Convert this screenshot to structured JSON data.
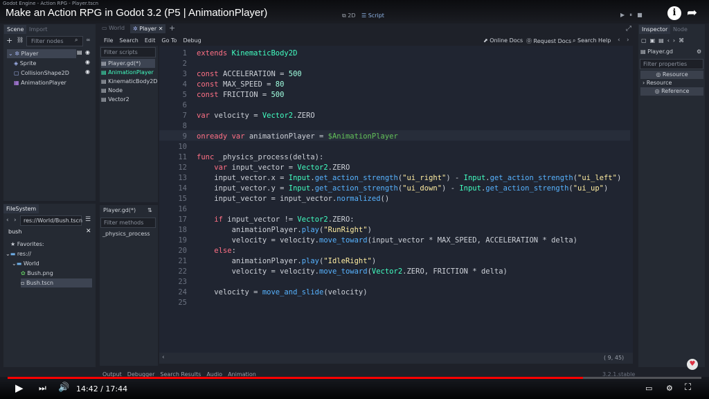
{
  "engine_title": "Godot Engine - Action RPG - Player.tscn",
  "video_title": "Make an Action RPG in Godot 3.2 (P5 | AnimationPlayer)",
  "workspace": {
    "mode_2d": "2D",
    "mode_script": "Script"
  },
  "scene_dock": {
    "tabs": [
      "Scene",
      "Import"
    ],
    "filter_placeholder": "Filter nodes",
    "nodes": [
      {
        "label": "Player",
        "icon": "kinematic-body-icon",
        "depth": 0
      },
      {
        "label": "Sprite",
        "icon": "sprite-icon",
        "depth": 1
      },
      {
        "label": "CollisionShape2D",
        "icon": "collision-shape-icon",
        "depth": 1
      },
      {
        "label": "AnimationPlayer",
        "icon": "animation-player-icon",
        "depth": 1
      }
    ]
  },
  "filesystem_dock": {
    "tab": "FileSystem",
    "path": "res://World/Bush.tscn",
    "search": "bush",
    "items": [
      {
        "label": "Favorites:",
        "icon": "star-icon",
        "depth": 0
      },
      {
        "label": "res://",
        "icon": "folder-icon",
        "depth": 0
      },
      {
        "label": "World",
        "icon": "folder-icon",
        "depth": 1
      },
      {
        "label": "Bush.png",
        "icon": "image-icon",
        "depth": 2
      },
      {
        "label": "Bush.tscn",
        "icon": "scene-icon",
        "depth": 2
      }
    ]
  },
  "editor_tabs": [
    "World",
    "Player"
  ],
  "script_menu": [
    "File",
    "Search",
    "Edit",
    "Go To",
    "Debug"
  ],
  "script_toolbar": [
    "Online Docs",
    "Request Docs",
    "Search Help"
  ],
  "script_list": {
    "filter_placeholder": "Filter scripts",
    "items": [
      "Player.gd(*)",
      "AnimationPlayer",
      "KinematicBody2D",
      "Node",
      "Vector2"
    ]
  },
  "method_panel": {
    "title": "Player.gd(*)",
    "filter_placeholder": "Filter methods",
    "methods": [
      "_physics_process"
    ]
  },
  "code_lines": [
    {
      "n": "1",
      "tokens": [
        {
          "t": "extends ",
          "c": "kw"
        },
        {
          "t": "KinematicBody2D",
          "c": "ty"
        }
      ]
    },
    {
      "n": "2",
      "tokens": []
    },
    {
      "n": "3",
      "tokens": [
        {
          "t": "const ",
          "c": "kw"
        },
        {
          "t": "ACCELERATION = ",
          "c": "tx"
        },
        {
          "t": "500",
          "c": "nu"
        }
      ]
    },
    {
      "n": "4",
      "tokens": [
        {
          "t": "const ",
          "c": "kw"
        },
        {
          "t": "MAX_SPEED = ",
          "c": "tx"
        },
        {
          "t": "80",
          "c": "nu"
        }
      ]
    },
    {
      "n": "5",
      "tokens": [
        {
          "t": "const ",
          "c": "kw"
        },
        {
          "t": "FRICTION = ",
          "c": "tx"
        },
        {
          "t": "500",
          "c": "nu"
        }
      ]
    },
    {
      "n": "6",
      "tokens": []
    },
    {
      "n": "7",
      "tokens": [
        {
          "t": "var ",
          "c": "kw"
        },
        {
          "t": "velocity = ",
          "c": "tx"
        },
        {
          "t": "Vector2",
          "c": "ty"
        },
        {
          "t": ".ZERO",
          "c": "tx"
        }
      ]
    },
    {
      "n": "8",
      "tokens": []
    },
    {
      "n": "9",
      "tokens": [
        {
          "t": "onready var ",
          "c": "kw"
        },
        {
          "t": "animationPlayer = ",
          "c": "tx"
        },
        {
          "t": "$AnimationPlayer",
          "c": "np"
        }
      ]
    },
    {
      "n": "10",
      "tokens": []
    },
    {
      "n": "11",
      "tokens": [
        {
          "t": "func ",
          "c": "kw"
        },
        {
          "t": "_physics_process(delta):",
          "c": "tx"
        }
      ]
    },
    {
      "n": "12",
      "tokens": [
        {
          "t": "    var ",
          "c": "kw"
        },
        {
          "t": "input_vector = ",
          "c": "tx"
        },
        {
          "t": "Vector2",
          "c": "ty"
        },
        {
          "t": ".ZERO",
          "c": "tx"
        }
      ]
    },
    {
      "n": "13",
      "tokens": [
        {
          "t": "    input_vector.x = ",
          "c": "tx"
        },
        {
          "t": "Input",
          "c": "ty"
        },
        {
          "t": ".",
          "c": "tx"
        },
        {
          "t": "get_action_strength",
          "c": "fn"
        },
        {
          "t": "(",
          "c": "tx"
        },
        {
          "t": "\"ui_right\"",
          "c": "st"
        },
        {
          "t": ") - ",
          "c": "tx"
        },
        {
          "t": "Input",
          "c": "ty"
        },
        {
          "t": ".",
          "c": "tx"
        },
        {
          "t": "get_action_strength",
          "c": "fn"
        },
        {
          "t": "(",
          "c": "tx"
        },
        {
          "t": "\"ui_left\"",
          "c": "st"
        },
        {
          "t": ")",
          "c": "tx"
        }
      ]
    },
    {
      "n": "14",
      "tokens": [
        {
          "t": "    input_vector.y = ",
          "c": "tx"
        },
        {
          "t": "Input",
          "c": "ty"
        },
        {
          "t": ".",
          "c": "tx"
        },
        {
          "t": "get_action_strength",
          "c": "fn"
        },
        {
          "t": "(",
          "c": "tx"
        },
        {
          "t": "\"ui_down\"",
          "c": "st"
        },
        {
          "t": ") - ",
          "c": "tx"
        },
        {
          "t": "Input",
          "c": "ty"
        },
        {
          "t": ".",
          "c": "tx"
        },
        {
          "t": "get_action_strength",
          "c": "fn"
        },
        {
          "t": "(",
          "c": "tx"
        },
        {
          "t": "\"ui_up\"",
          "c": "st"
        },
        {
          "t": ")",
          "c": "tx"
        }
      ]
    },
    {
      "n": "15",
      "tokens": [
        {
          "t": "    input_vector = input_vector.",
          "c": "tx"
        },
        {
          "t": "normalized",
          "c": "fn"
        },
        {
          "t": "()",
          "c": "tx"
        }
      ]
    },
    {
      "n": "16",
      "tokens": []
    },
    {
      "n": "17",
      "tokens": [
        {
          "t": "    if ",
          "c": "kw"
        },
        {
          "t": "input_vector != ",
          "c": "tx"
        },
        {
          "t": "Vector2",
          "c": "ty"
        },
        {
          "t": ".ZERO:",
          "c": "tx"
        }
      ]
    },
    {
      "n": "18",
      "tokens": [
        {
          "t": "        animationPlayer.",
          "c": "tx"
        },
        {
          "t": "play",
          "c": "fn"
        },
        {
          "t": "(",
          "c": "tx"
        },
        {
          "t": "\"RunRight\"",
          "c": "st"
        },
        {
          "t": ")",
          "c": "tx"
        }
      ]
    },
    {
      "n": "19",
      "tokens": [
        {
          "t": "        velocity = velocity.",
          "c": "tx"
        },
        {
          "t": "move_toward",
          "c": "fn"
        },
        {
          "t": "(input_vector * MAX_SPEED, ACCELERATION * delta)",
          "c": "tx"
        }
      ]
    },
    {
      "n": "20",
      "tokens": [
        {
          "t": "    else",
          "c": "kw"
        },
        {
          "t": ":",
          "c": "tx"
        }
      ]
    },
    {
      "n": "21",
      "tokens": [
        {
          "t": "        animationPlayer.",
          "c": "tx"
        },
        {
          "t": "play",
          "c": "fn"
        },
        {
          "t": "(",
          "c": "tx"
        },
        {
          "t": "\"IdleRight\"",
          "c": "st"
        },
        {
          "t": ")",
          "c": "tx"
        }
      ]
    },
    {
      "n": "22",
      "tokens": [
        {
          "t": "        velocity = velocity.",
          "c": "tx"
        },
        {
          "t": "move_toward",
          "c": "fn"
        },
        {
          "t": "(",
          "c": "tx"
        },
        {
          "t": "Vector2",
          "c": "ty"
        },
        {
          "t": ".ZERO, FRICTION * delta)",
          "c": "tx"
        }
      ]
    },
    {
      "n": "23",
      "tokens": []
    },
    {
      "n": "24",
      "tokens": [
        {
          "t": "    velocity = ",
          "c": "tx"
        },
        {
          "t": "move_and_slide",
          "c": "fn"
        },
        {
          "t": "(velocity)",
          "c": "tx"
        }
      ]
    },
    {
      "n": "25",
      "tokens": []
    }
  ],
  "cursor_position": "9, 45",
  "bottom_tabs": [
    "Output",
    "Debugger",
    "Search Results",
    "Audio",
    "Animation"
  ],
  "version": "3.2.1.stable",
  "inspector": {
    "tabs": [
      "Inspector",
      "Node"
    ],
    "object": "Player.gd",
    "filter_placeholder": "Filter properties",
    "section": "Resource",
    "subsection": "Resource",
    "field": "Reference"
  },
  "video": {
    "current": "14:42",
    "total": "17:44",
    "progress": 0.829
  }
}
